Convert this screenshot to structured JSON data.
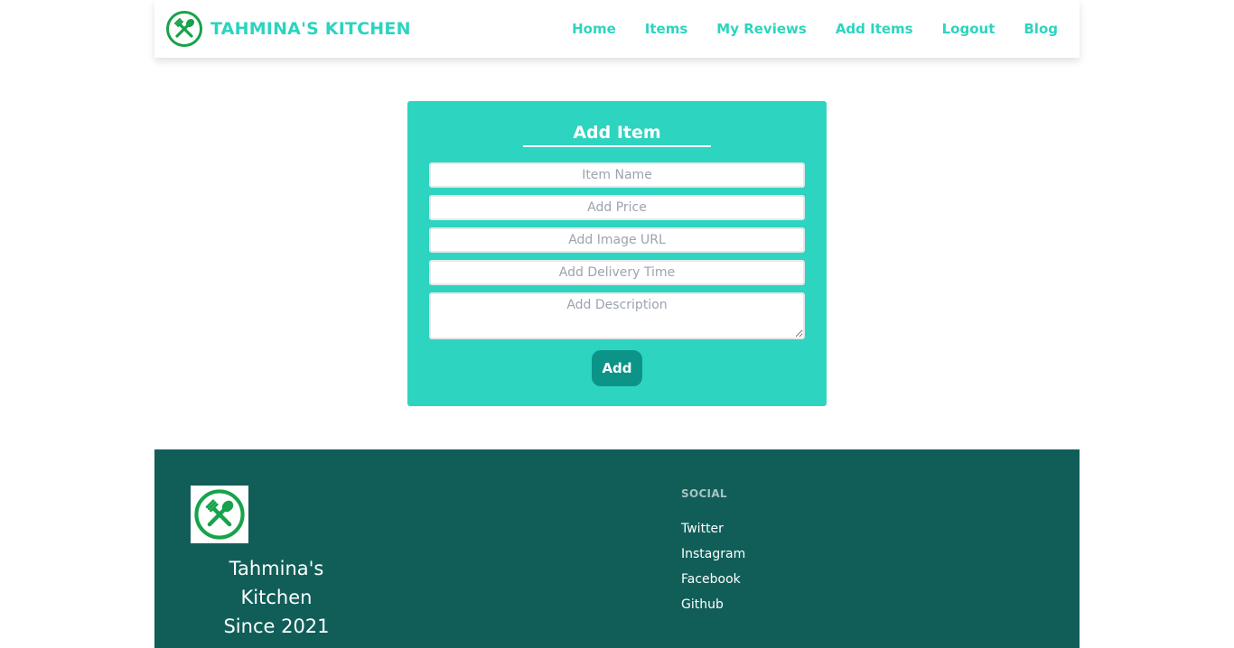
{
  "brand": {
    "name": "TAHMINA'S KITCHEN",
    "icon": "fork-spoon-logo-icon",
    "color": "#2dd4bf",
    "logo_color": "#16a34a"
  },
  "nav": {
    "items": [
      {
        "label": "Home"
      },
      {
        "label": "Items"
      },
      {
        "label": "My Reviews"
      },
      {
        "label": "Add Items"
      },
      {
        "label": "Logout"
      },
      {
        "label": "Blog"
      }
    ]
  },
  "form": {
    "title": "Add Item",
    "fields": {
      "item_name": {
        "placeholder": "Item Name",
        "value": ""
      },
      "price": {
        "placeholder": "Add Price",
        "value": ""
      },
      "image_url": {
        "placeholder": "Add Image URL",
        "value": ""
      },
      "delivery_time": {
        "placeholder": "Add Delivery Time",
        "value": ""
      },
      "description": {
        "placeholder": "Add Description",
        "value": ""
      }
    },
    "submit_label": "Add",
    "card_color": "#2dd4bf",
    "button_color": "#0d9488"
  },
  "footer": {
    "background": "#115e59",
    "brand_line1": "Tahmina's Kitchen",
    "brand_line2": "Since 2021",
    "social": {
      "heading": "SOCIAL",
      "links": [
        {
          "label": "Twitter"
        },
        {
          "label": "Instagram"
        },
        {
          "label": "Facebook"
        },
        {
          "label": "Github"
        }
      ]
    }
  }
}
